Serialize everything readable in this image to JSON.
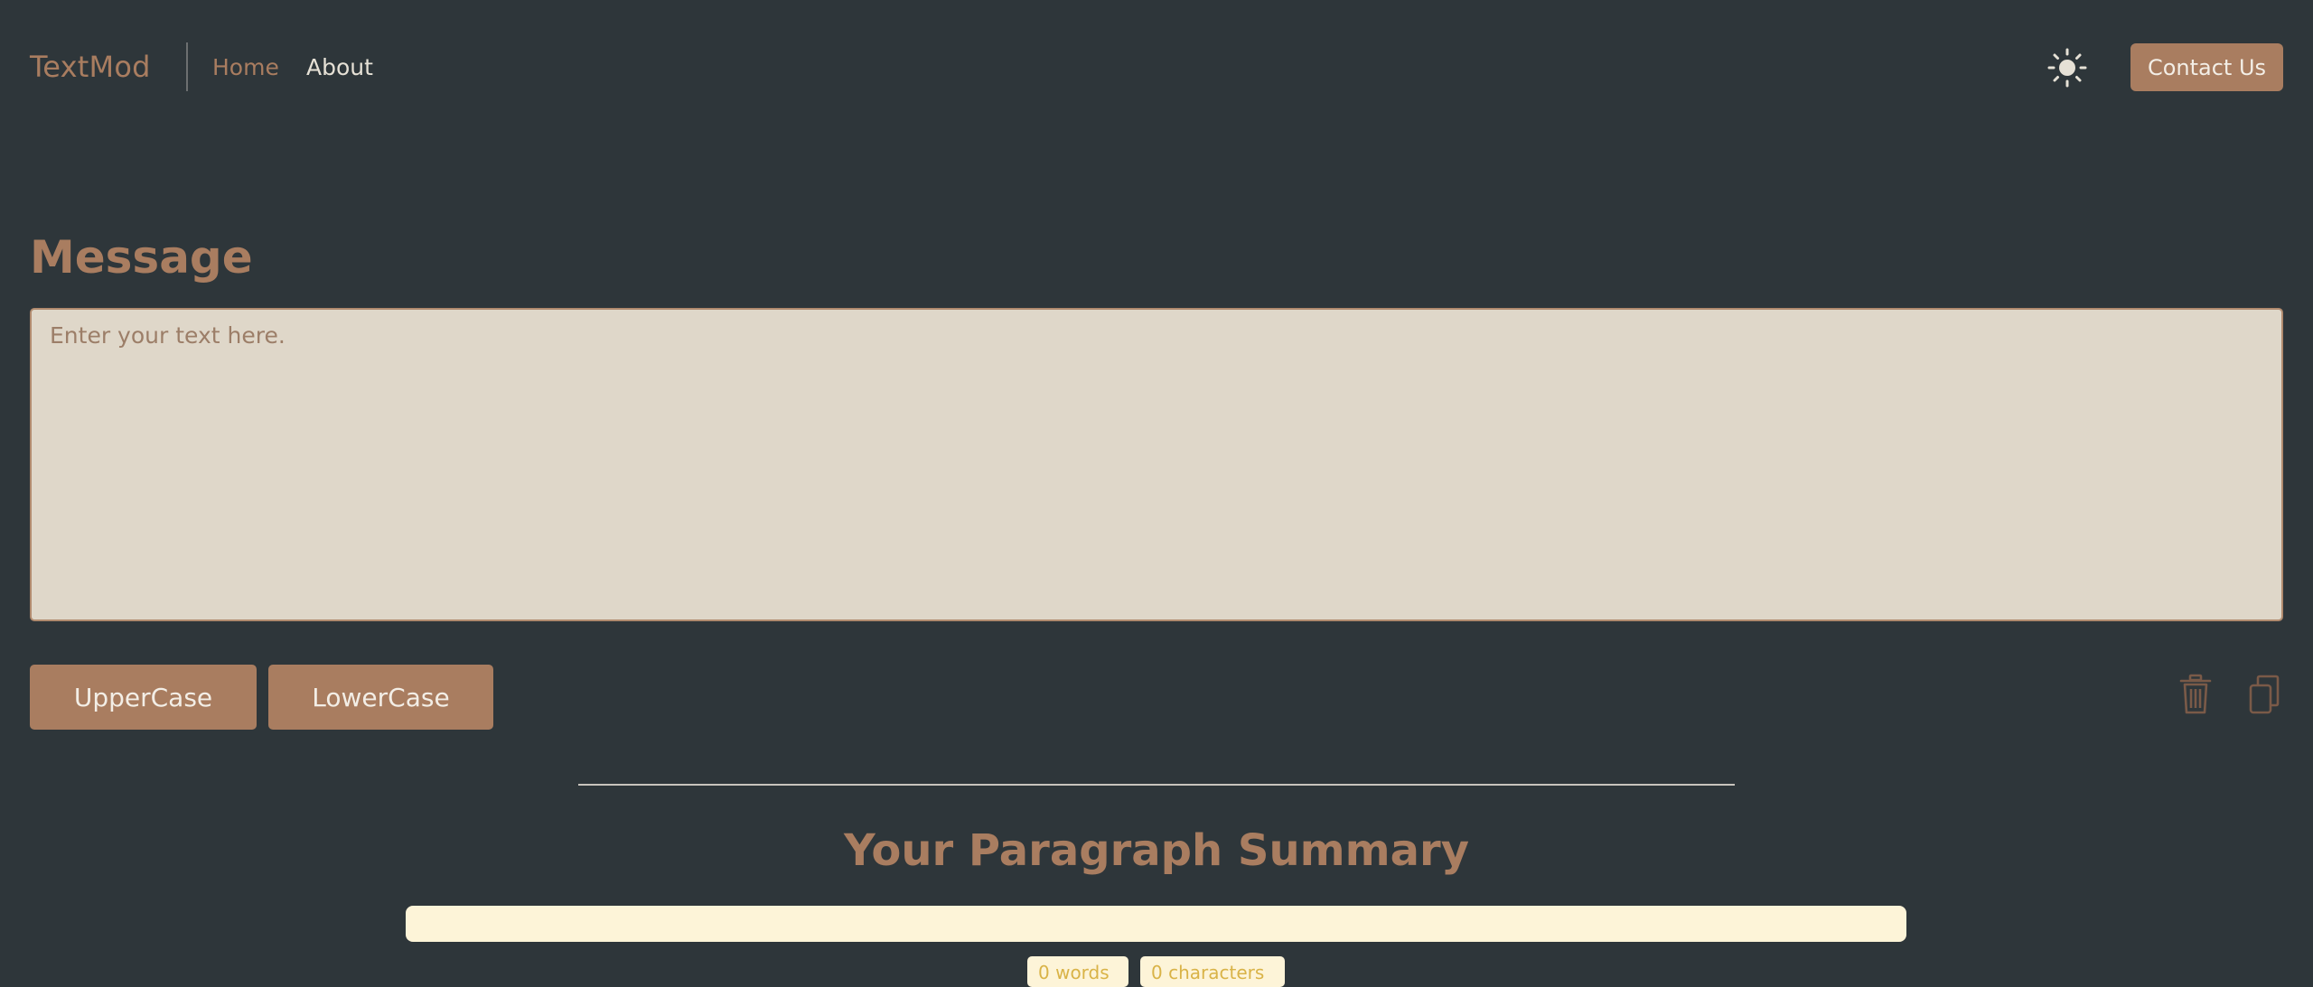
{
  "navbar": {
    "brand": "TextMod",
    "links": [
      {
        "label": "Home",
        "active": true
      },
      {
        "label": "About",
        "active": false
      }
    ],
    "theme_toggle_icon": "sun-icon",
    "contact_label": "Contact Us"
  },
  "message": {
    "heading": "Message",
    "placeholder": "Enter your text here.",
    "value": ""
  },
  "actions": {
    "uppercase_label": "UpperCase",
    "lowercase_label": "LowerCase",
    "clear_icon": "trash-icon",
    "copy_icon": "copy-icon"
  },
  "summary": {
    "heading": "Your Paragraph Summary",
    "preview": "",
    "words_badge": "0 words",
    "characters_badge": "0 characters"
  },
  "colors": {
    "background": "#2e363a",
    "accent": "#a97d60",
    "textarea_bg": "#dfd7c9",
    "summary_bg": "#fdf4d8",
    "badge_text": "#d9b347"
  }
}
